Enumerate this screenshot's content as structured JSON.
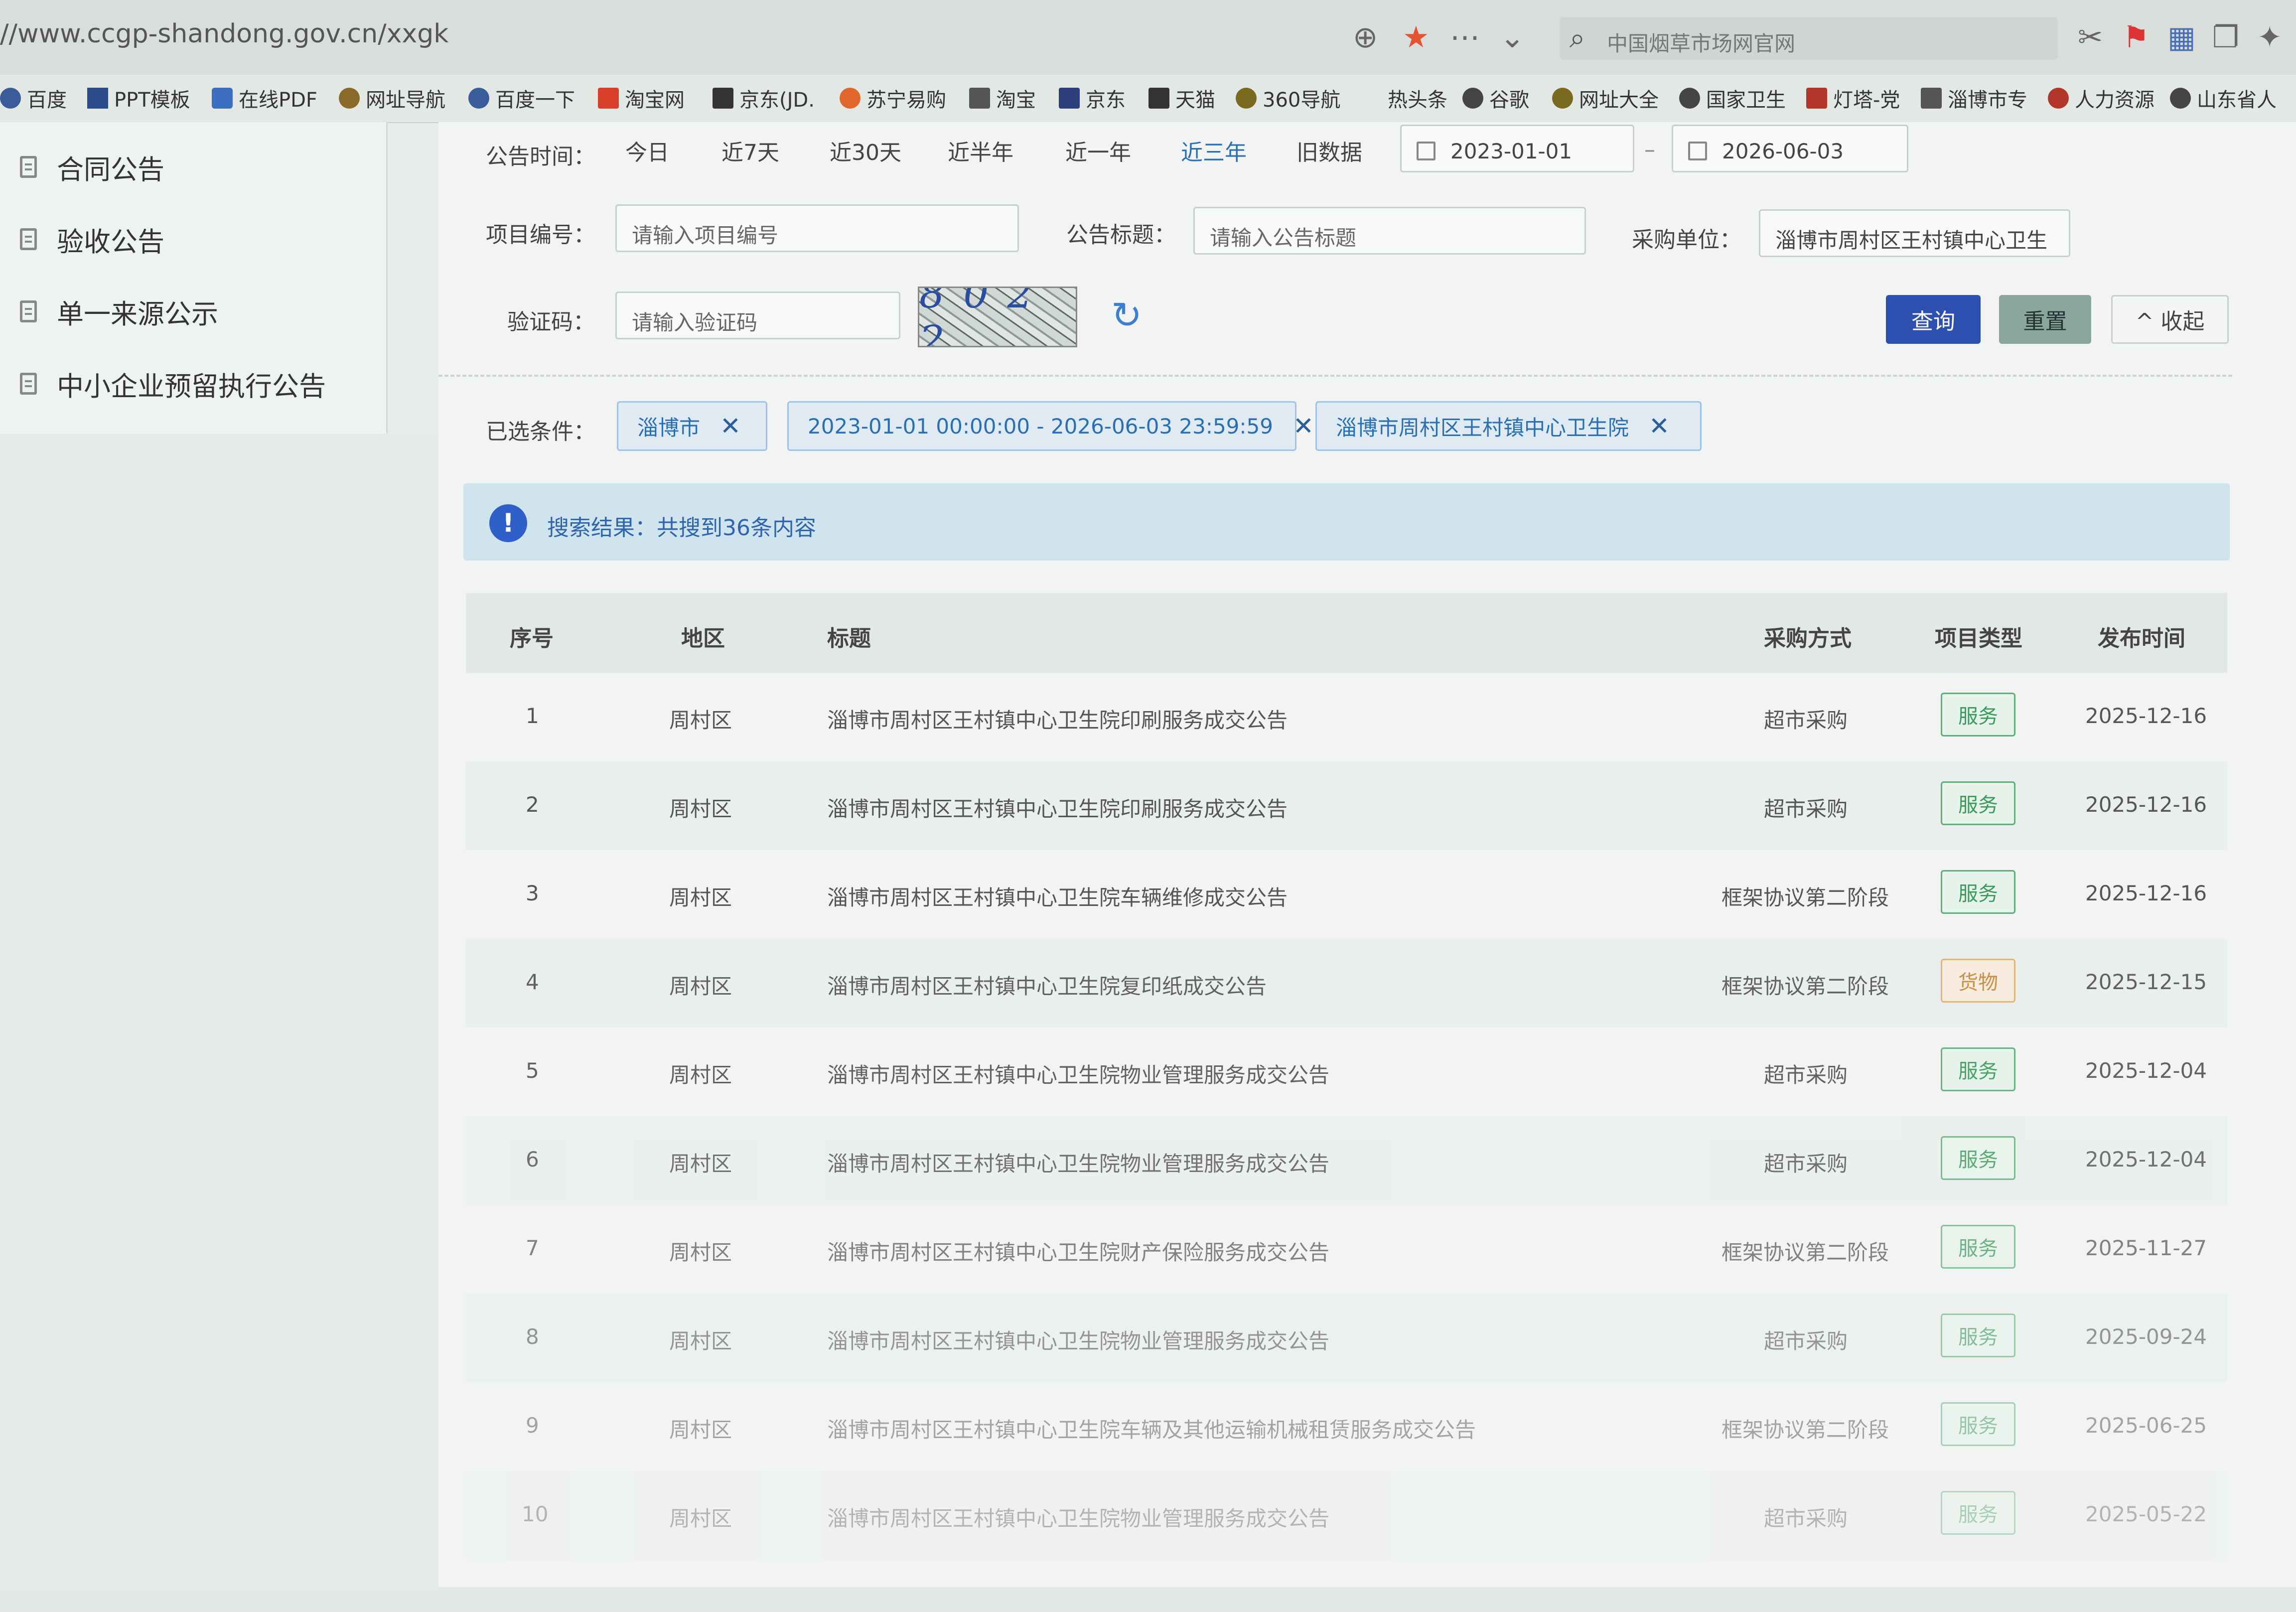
{
  "browser": {
    "url": "//www.ccgp-shandong.gov.cn/xxgk",
    "search_text": "中国烟草市场网官网",
    "bookmarks": [
      "百度",
      "PPT模板",
      "在线PDF",
      "网址导航",
      "百度一下",
      "淘宝网",
      "京东(JD.",
      "苏宁易购",
      "淘宝",
      "京东",
      "天猫",
      "360导航",
      "热头条",
      "谷歌",
      "网址大全",
      "国家卫生",
      "灯塔-党",
      "淄博市专",
      "人力资源",
      "山东省人"
    ]
  },
  "sidebar": {
    "items": [
      {
        "label": "合同公告"
      },
      {
        "label": "验收公告"
      },
      {
        "label": "单一来源公示"
      },
      {
        "label": "中小企业预留执行公告"
      }
    ]
  },
  "filters": {
    "time_label": "公告时间：",
    "quick_ranges": [
      "今日",
      "近7天",
      "近30天",
      "近半年",
      "近一年",
      "近三年",
      "旧数据"
    ],
    "date_start": "2023-01-01",
    "date_sep": "–",
    "date_end": "2026-06-03",
    "project_no_label": "项目编号：",
    "project_no_placeholder": "请输入项目编号",
    "title_label": "公告标题：",
    "title_placeholder": "请输入公告标题",
    "buyer_label": "采购单位：",
    "buyer_value": "淄博市周村区王村镇中心卫生",
    "captcha_label": "验证码：",
    "captcha_placeholder": "请输入验证码",
    "captcha_text": "8 0 2 2",
    "search_button": "查询",
    "reset_button": "重置",
    "collapse_button": "^ 收起"
  },
  "selected": {
    "label": "已选条件：",
    "tags": [
      "淄博市",
      "2023-01-01 00:00:00 - 2026-06-03 23:59:59",
      "淄博市周村区王村镇中心卫生院"
    ]
  },
  "result": {
    "text": "搜索结果：共搜到36条内容"
  },
  "table": {
    "columns": [
      "序号",
      "地区",
      "标题",
      "采购方式",
      "项目类型",
      "发布时间"
    ],
    "rows": [
      {
        "no": "1",
        "region": "周村区",
        "title": "淄博市周村区王村镇中心卫生院印刷服务成交公告",
        "method": "超市采购",
        "type": "服务",
        "date": "2025-12-16"
      },
      {
        "no": "2",
        "region": "周村区",
        "title": "淄博市周村区王村镇中心卫生院印刷服务成交公告",
        "method": "超市采购",
        "type": "服务",
        "date": "2025-12-16"
      },
      {
        "no": "3",
        "region": "周村区",
        "title": "淄博市周村区王村镇中心卫生院车辆维修成交公告",
        "method": "框架协议第二阶段",
        "type": "服务",
        "date": "2025-12-16"
      },
      {
        "no": "4",
        "region": "周村区",
        "title": "淄博市周村区王村镇中心卫生院复印纸成交公告",
        "method": "框架协议第二阶段",
        "type": "货物",
        "date": "2025-12-15"
      },
      {
        "no": "5",
        "region": "周村区",
        "title": "淄博市周村区王村镇中心卫生院物业管理服务成交公告",
        "method": "超市采购",
        "type": "服务",
        "date": "2025-12-04"
      },
      {
        "no": "6",
        "region": "周村区",
        "title": "淄博市周村区王村镇中心卫生院物业管理服务成交公告",
        "method": "超市采购",
        "type": "服务",
        "date": "2025-12-04"
      },
      {
        "no": "7",
        "region": "周村区",
        "title": "淄博市周村区王村镇中心卫生院财产保险服务成交公告",
        "method": "框架协议第二阶段",
        "type": "服务",
        "date": "2025-11-27"
      },
      {
        "no": "8",
        "region": "周村区",
        "title": "淄博市周村区王村镇中心卫生院物业管理服务成交公告",
        "method": "超市采购",
        "type": "服务",
        "date": "2025-09-24"
      },
      {
        "no": "9",
        "region": "周村区",
        "title": "淄博市周村区王村镇中心卫生院车辆及其他运输机械租赁服务成交公告",
        "method": "框架协议第二阶段",
        "type": "服务",
        "date": "2025-06-25"
      },
      {
        "no": "10",
        "region": "周村区",
        "title": "淄博市周村区王村镇中心卫生院物业管理服务成交公告",
        "method": "超市采购",
        "type": "服务",
        "date": "2025-05-22"
      }
    ]
  },
  "colors": {
    "primary_button": "#2c4fb0",
    "service_badge": "#3b9a5b",
    "goods_badge": "#c7883a",
    "tag_text": "#2a6fb3"
  }
}
